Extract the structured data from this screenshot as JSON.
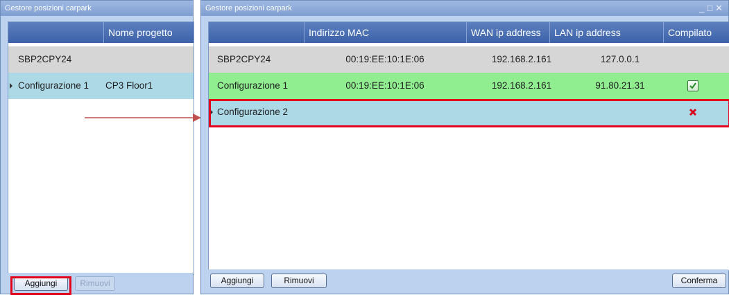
{
  "left_window": {
    "title": "Gestore posizioni carpark",
    "columns": [
      "",
      "Nome progetto"
    ],
    "rows": [
      {
        "name": "SBP2CPY24",
        "project": ""
      },
      {
        "name": "Configurazione 1",
        "project": "CP3 Floor1"
      }
    ],
    "buttons": {
      "add": "Aggiungi",
      "remove": "Rimuovi"
    }
  },
  "right_window": {
    "title": "Gestore posizioni carpark",
    "columns": [
      "",
      "Indirizzo MAC",
      "WAN ip address",
      "LAN ip address",
      "Compilato"
    ],
    "rows": [
      {
        "name": "SBP2CPY24",
        "mac": "00:19:EE:10:1E:06",
        "wan": "192.168.2.161",
        "lan": "127.0.0.1",
        "compiled": ""
      },
      {
        "name": "Configurazione 1",
        "mac": "00:19:EE:10:1E:06",
        "wan": "192.168.2.161",
        "lan": "91.80.21.31",
        "compiled": "check-icon"
      },
      {
        "name": "Configurazione 2",
        "mac": "",
        "wan": "",
        "lan": "",
        "compiled": "x-icon"
      }
    ],
    "buttons": {
      "add": "Aggiungi",
      "remove": "Rimuovi",
      "confirm": "Conferma"
    }
  },
  "colors": {
    "highlight": "#e0001b",
    "arrow": "#c0504d",
    "row_gray": "#d6d6d6",
    "row_green": "#90ee90",
    "row_blue": "#add8e6",
    "header": "#4a70b4"
  }
}
